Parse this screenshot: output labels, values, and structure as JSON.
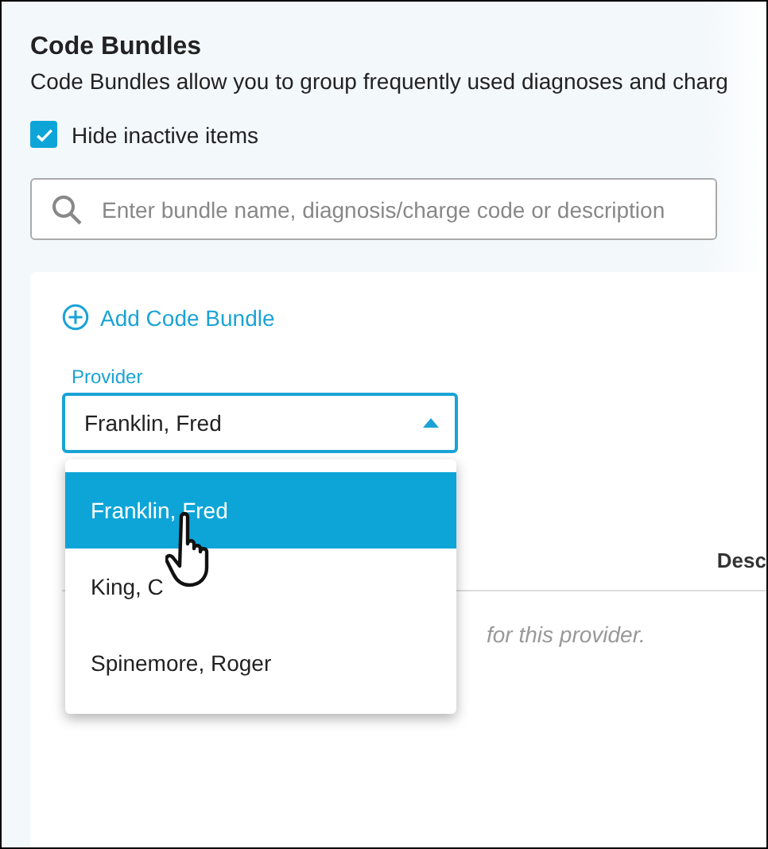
{
  "header": {
    "title": "Code Bundles",
    "description": "Code Bundles allow you to group frequently used diagnoses and charg"
  },
  "hide_inactive": {
    "label": "Hide inactive items",
    "checked": true
  },
  "search": {
    "placeholder": "Enter bundle name, diagnosis/charge code or description"
  },
  "add_link": "Add Code Bundle",
  "provider": {
    "label": "Provider",
    "value": "Franklin, Fred",
    "expanded": true,
    "options": [
      {
        "label": "Franklin, Fred",
        "selected": true
      },
      {
        "label": "King, C",
        "selected": false
      },
      {
        "label": "Spinemore, Roger",
        "selected": false
      }
    ]
  },
  "table": {
    "columns": [
      "Desc"
    ],
    "empty_message": "for this provider."
  }
}
